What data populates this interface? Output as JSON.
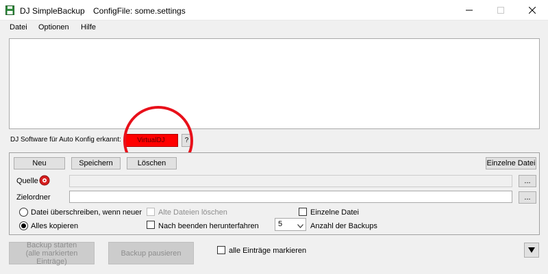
{
  "window": {
    "title": "DJ SimpleBackup",
    "config_file": "ConfigFile: some.settings"
  },
  "menu": {
    "items": [
      "Datei",
      "Optionen",
      "Hilfe"
    ]
  },
  "detection": {
    "label": "DJ Software für Auto Konfig erkannt:",
    "value": "VirtualDJ",
    "help_label": "?",
    "value_color": "#ff0000",
    "highlight_color": "#e8101a"
  },
  "actions": {
    "neu": "Neu",
    "speichern": "Speichern",
    "loeschen": "Löschen",
    "einzelne_datei": "Einzelne Datei"
  },
  "fields": {
    "quelle_label": "Quelle",
    "quelle_value": "",
    "zielordner_label": "Zielordner",
    "zielordner_value": "",
    "browse_label": "..."
  },
  "options": {
    "overwrite_newer": "Datei überschreiben, wenn neuer",
    "copy_all": "Alles kopieren",
    "delete_old": "Alte Dateien löschen",
    "shutdown_after": "Nach beenden herunterfahren",
    "single_file": "Einzelne Datei",
    "backup_count_value": "5",
    "backup_count_label": "Anzahl der Backups"
  },
  "footer": {
    "start_backup_line1": "Backup starten",
    "start_backup_line2": "(alle markierten Einträge)",
    "pause_backup": "Backup pausieren",
    "mark_all": "alle Einträge markieren"
  }
}
